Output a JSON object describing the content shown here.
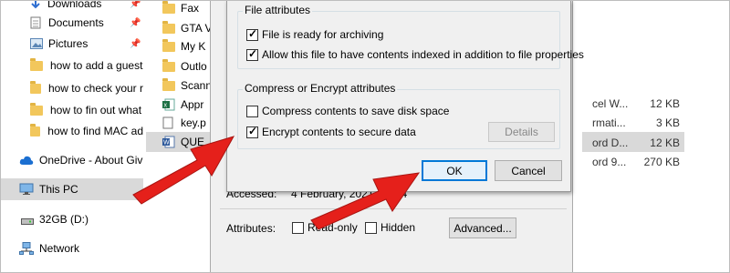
{
  "nav": {
    "downloads": "Downloads",
    "documents": "Documents",
    "pictures": "Pictures",
    "folders": [
      "how to add a guest",
      "how to check your r",
      "how to fin out what",
      "how to find MAC ad"
    ],
    "onedrive": "OneDrive - About Giv",
    "this_pc": "This PC",
    "drive": "32GB (D:)",
    "network": "Network"
  },
  "files": {
    "names": [
      "Fax",
      "GTA V",
      "My K",
      "Outlo",
      "Scann",
      "Appr",
      "key.p",
      "QUE"
    ],
    "types": [
      "cel W...",
      "rmati...",
      "ord D...",
      "ord 9..."
    ],
    "sizes": [
      "12 KB",
      "3 KB",
      "12 KB",
      "270 KB"
    ]
  },
  "properties": {
    "accessed_label": "Accessed:",
    "accessed_value": "4 February, 2021, 19:54",
    "attributes_label": "Attributes:",
    "readonly_label": "Read-only",
    "hidden_label": "Hidden",
    "advanced_button": "Advanced..."
  },
  "dialog": {
    "file_attributes_title": "File attributes",
    "archive_label": "File is ready for archiving",
    "index_label": "Allow this file to have contents indexed in addition to file properties",
    "compress_encrypt_title": "Compress or Encrypt attributes",
    "compress_label": "Compress contents to save disk space",
    "encrypt_label": "Encrypt contents to secure data",
    "details_button": "Details",
    "ok_button": "OK",
    "cancel_button": "Cancel",
    "archive_checked": true,
    "index_checked": true,
    "compress_checked": false,
    "encrypt_checked": true
  },
  "colors": {
    "arrow": "#e5201b",
    "selection": "#d9d9d9",
    "ok_border": "#0078d7"
  }
}
